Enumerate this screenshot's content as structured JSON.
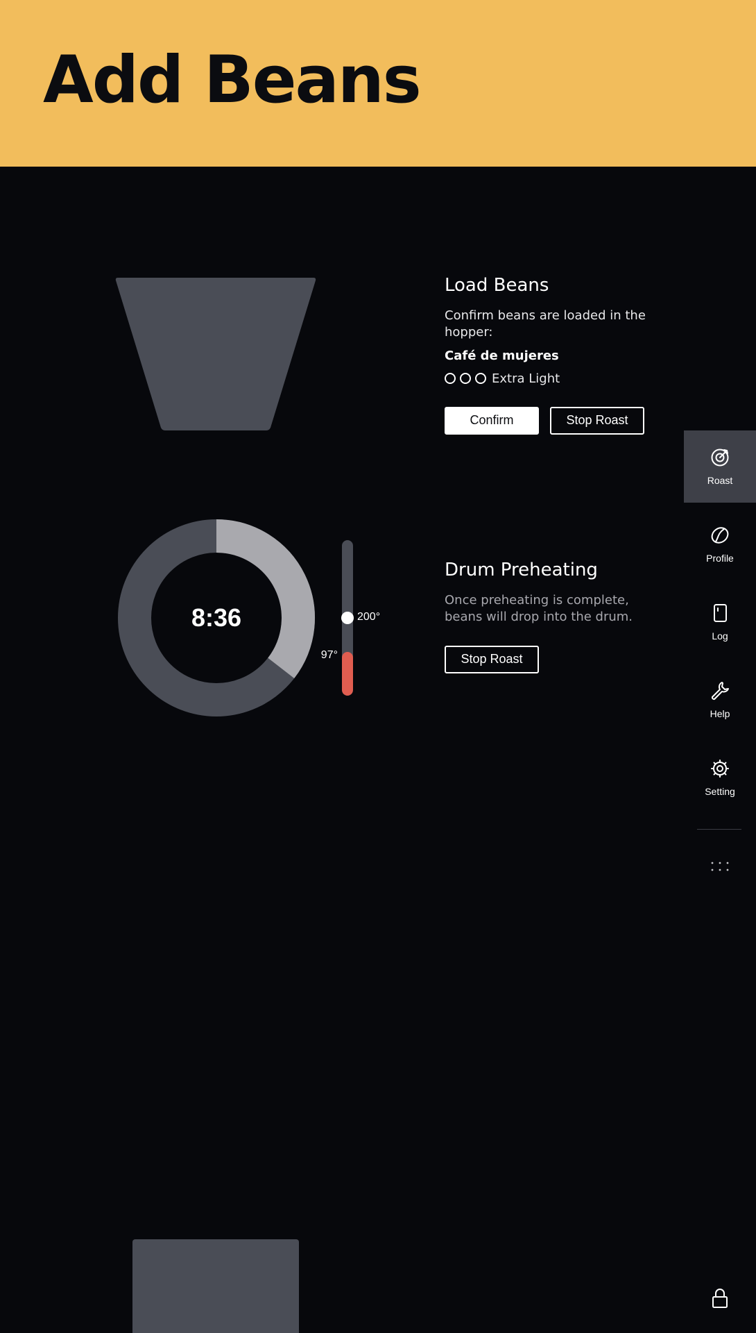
{
  "header": {
    "title": "Add Beans",
    "background": "#f2bd5c"
  },
  "load_beans": {
    "title": "Load Beans",
    "description": "Confirm beans are loaded in the hopper:",
    "bean_name": "Café de mujeres",
    "roast_level": {
      "label": "Extra Light",
      "dots_filled": 0,
      "dots_total": 3
    },
    "confirm_label": "Confirm",
    "stop_label": "Stop Roast"
  },
  "preheat": {
    "title": "Drum Preheating",
    "description": "Once preheating is complete, beans will drop into the drum.",
    "stop_label": "Stop Roast"
  },
  "timer": {
    "value": "8:36",
    "progress": 0.355
  },
  "thermometer": {
    "current_label": "97°",
    "target_label": "200°",
    "current_fraction": 0.28,
    "target_fraction": 0.5,
    "fill_color": "#e05d50"
  },
  "sidebar": {
    "items": [
      {
        "label": "Roast",
        "icon": "target-icon",
        "active": true
      },
      {
        "label": "Profile",
        "icon": "bean-icon",
        "active": false
      },
      {
        "label": "Log",
        "icon": "notebook-icon",
        "active": false
      },
      {
        "label": "Help",
        "icon": "wrench-icon",
        "active": false
      },
      {
        "label": "Setting",
        "icon": "gear-icon",
        "active": false
      }
    ],
    "more_icon": "more-dots-icon",
    "lock_icon": "lock-icon"
  },
  "colors": {
    "background": "#07080c",
    "panel_gray": "#4a4d56",
    "ring_progress": "#a9a9ae",
    "active_nav": "#3e4048"
  }
}
